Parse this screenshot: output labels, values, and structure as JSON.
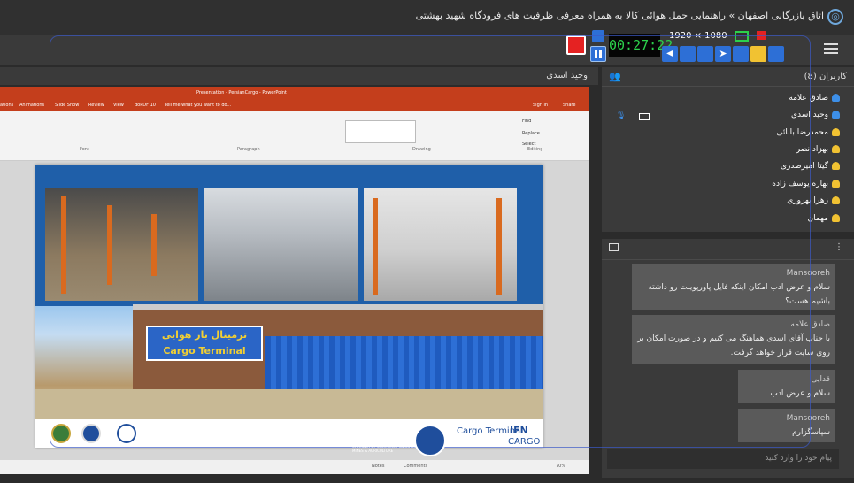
{
  "window": {
    "title": "اتاق بازرگانی اصفهان » راهنمایی حمل هوائی کالا به همراه معرفی ظرفیت های فرودگاه شهید بهشتی"
  },
  "recorder": {
    "timer": "00:27:22",
    "resolution": "1920 × 1080"
  },
  "presentation": {
    "presenter": "وحید اسدی",
    "ppt_title": "Presentation - PersianCargo - PowerPoint",
    "ribbon_tabs": [
      "ations",
      "Animations",
      "Slide Show",
      "Review",
      "View",
      "doPDF 10",
      "Tell me what you want to do..."
    ],
    "ribbon_right": [
      "Sign in",
      "Share"
    ],
    "ribbon_groups": [
      "Font",
      "Paragraph",
      "Drawing",
      "Editing"
    ],
    "editing_buttons": [
      "Find",
      "Replace",
      "Select"
    ],
    "slide_sign_fa": "ترمینال بار هوایی",
    "slide_sign_en": "Cargo Terminal",
    "status_items": [
      "Notes",
      "Comments",
      "70%"
    ],
    "accent": "#c43e1c"
  },
  "users": {
    "header": "کاربران (8)",
    "list": [
      {
        "name": "صادق علامه",
        "color": "#3d8fe8"
      },
      {
        "name": "وحید اسدی",
        "color": "#3d8fe8"
      },
      {
        "name": "محمدرضا بابائی",
        "color": "#f1c232"
      },
      {
        "name": "بهزاد نصر",
        "color": "#f1c232"
      },
      {
        "name": "گیتا امیرصدری",
        "color": "#f1c232"
      },
      {
        "name": "بهاره یوسف زاده",
        "color": "#f1c232"
      },
      {
        "name": "زهرا بهروزی",
        "color": "#f1c232"
      },
      {
        "name": "مهمان",
        "color": "#f1c232"
      }
    ]
  },
  "chat": {
    "messages": [
      {
        "author": "Mansooreh",
        "text": "سلام و عرض ادب امکان اینکه فایل پاورپوینت رو داشته باشیم هست؟"
      },
      {
        "author": "صادق علامه",
        "text": "با جناب آقای اسدی هماهنگ می کنیم و در صورت امکان بر روی سایت قرار خواهد گرفت."
      },
      {
        "author": "قدایی",
        "text": "سلام و عرض ادب"
      },
      {
        "author": "Mansooreh",
        "text": "سپاسگزارم"
      }
    ],
    "input_placeholder": "پیام خود را وارد کنید"
  },
  "overlay": {
    "brand": "ISFAHAN",
    "brand_sub": "CHAMBER OF COMMERCE INDUSTRIES, MINES & AGRICULTURE",
    "brand_fa": "اتاق بازرگانی اصفهان",
    "ifn": "IFN",
    "cargo_label": "Cargo Terminal",
    "cargo_short": "CARGO"
  }
}
